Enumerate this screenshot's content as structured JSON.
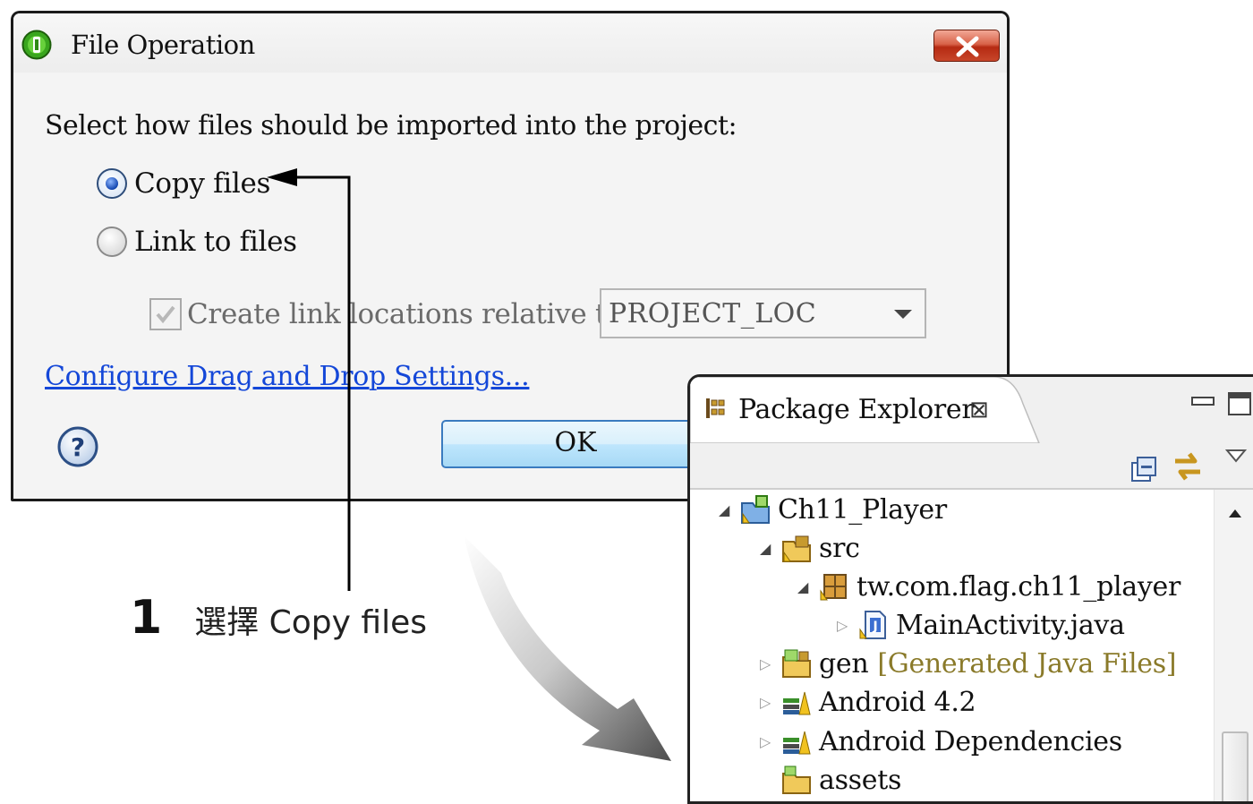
{
  "dialog": {
    "title": "File Operation",
    "prompt": "Select how files should be imported into the project:",
    "options": [
      {
        "label": "Copy files",
        "selected": true
      },
      {
        "label": "Link to files",
        "selected": false
      }
    ],
    "relative_checkbox": {
      "label": "Create link locations relative to:",
      "checked": true,
      "enabled": false
    },
    "relative_combo": {
      "value": "PROJECT_LOC",
      "enabled": false
    },
    "settings_link": "Configure Drag and Drop Settings...",
    "ok_label": "OK",
    "icons": {
      "app": "file-operation-icon",
      "close": "close-icon",
      "help": "help-icon"
    }
  },
  "package_explorer": {
    "tab_label": "Package Explorer",
    "tab_close": "⊠",
    "tree": [
      {
        "label": "Ch11_Player",
        "expanded": true,
        "icon": "android-project-icon"
      },
      {
        "label": "src",
        "expanded": true,
        "icon": "source-folder-icon"
      },
      {
        "label": "tw.com.flag.ch11_player",
        "expanded": true,
        "icon": "package-icon"
      },
      {
        "label": "MainActivity.java",
        "expanded": false,
        "icon": "java-file-icon"
      },
      {
        "label": "gen",
        "decoration": "[Generated Java Files]",
        "expanded": false,
        "icon": "gen-folder-icon"
      },
      {
        "label": "Android 4.2",
        "expanded": false,
        "icon": "library-icon"
      },
      {
        "label": "Android Dependencies",
        "expanded": false,
        "icon": "library-icon"
      },
      {
        "label": "assets",
        "expanded": null,
        "icon": "folder-icon"
      }
    ]
  },
  "annotation": {
    "number": "1",
    "text": "選擇 Copy files"
  },
  "colors": {
    "link": "#1447d8",
    "close_button": "#c8462a",
    "ok_border": "#3a7bbf",
    "decoration": "#8a7a2a"
  }
}
